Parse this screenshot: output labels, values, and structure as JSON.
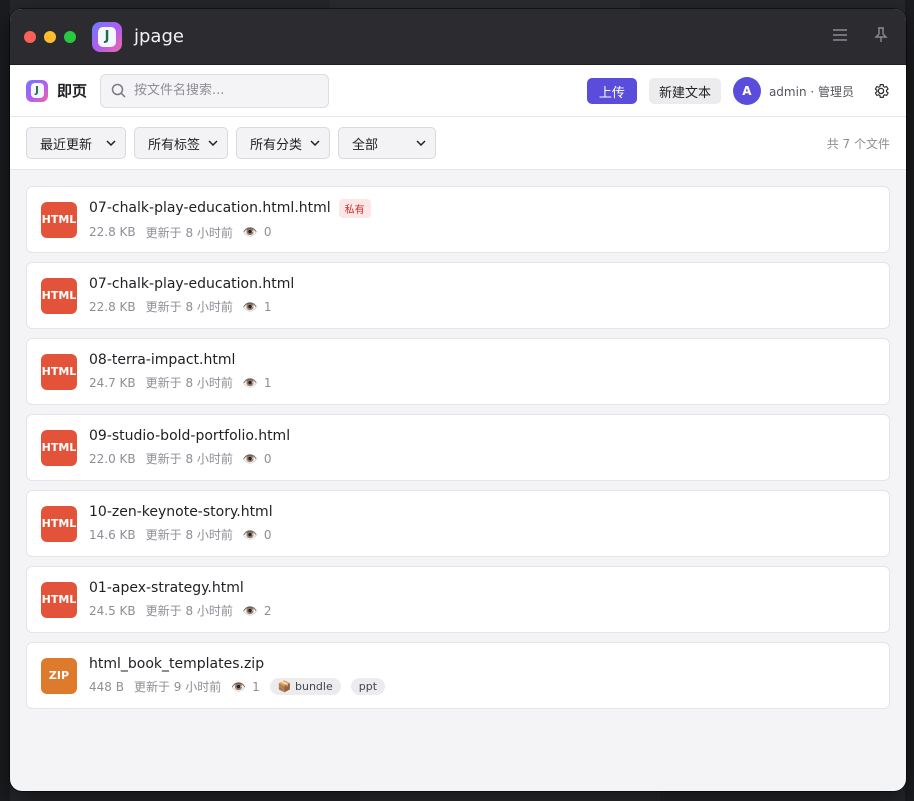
{
  "window": {
    "title": "jpage",
    "logo_glyph": "J"
  },
  "header": {
    "brand": "即页",
    "search_placeholder": "按文件名搜索...",
    "upload_label": "上传",
    "new_text_label": "新建文本",
    "avatar_letter": "A",
    "user_label": "admin · 管理员"
  },
  "filters": {
    "sort": "最近更新",
    "tags": "所有标签",
    "categories": "所有分类",
    "scope": "全部",
    "count": "共 7 个文件"
  },
  "colors": {
    "accent": "#5b4ddb",
    "html_icon": "#e2533a",
    "zip_icon": "#dd7a2c"
  },
  "files": [
    {
      "type_label": "HTML",
      "name": "07-chalk-play-education.html.html",
      "badge": "私有",
      "size": "22.8 KB",
      "updated": "更新于 8 小时前",
      "views": "0",
      "tags": []
    },
    {
      "type_label": "HTML",
      "name": "07-chalk-play-education.html",
      "badge": "",
      "size": "22.8 KB",
      "updated": "更新于 8 小时前",
      "views": "1",
      "tags": []
    },
    {
      "type_label": "HTML",
      "name": "08-terra-impact.html",
      "badge": "",
      "size": "24.7 KB",
      "updated": "更新于 8 小时前",
      "views": "1",
      "tags": []
    },
    {
      "type_label": "HTML",
      "name": "09-studio-bold-portfolio.html",
      "badge": "",
      "size": "22.0 KB",
      "updated": "更新于 8 小时前",
      "views": "0",
      "tags": []
    },
    {
      "type_label": "HTML",
      "name": "10-zen-keynote-story.html",
      "badge": "",
      "size": "14.6 KB",
      "updated": "更新于 8 小时前",
      "views": "0",
      "tags": []
    },
    {
      "type_label": "HTML",
      "name": "01-apex-strategy.html",
      "badge": "",
      "size": "24.5 KB",
      "updated": "更新于 8 小时前",
      "views": "2",
      "tags": []
    },
    {
      "type_label": "ZIP",
      "name": "html_book_templates.zip",
      "badge": "",
      "size": "448 B",
      "updated": "更新于 9 小时前",
      "views": "1",
      "tags": [
        "📦 bundle",
        "ppt"
      ]
    }
  ]
}
